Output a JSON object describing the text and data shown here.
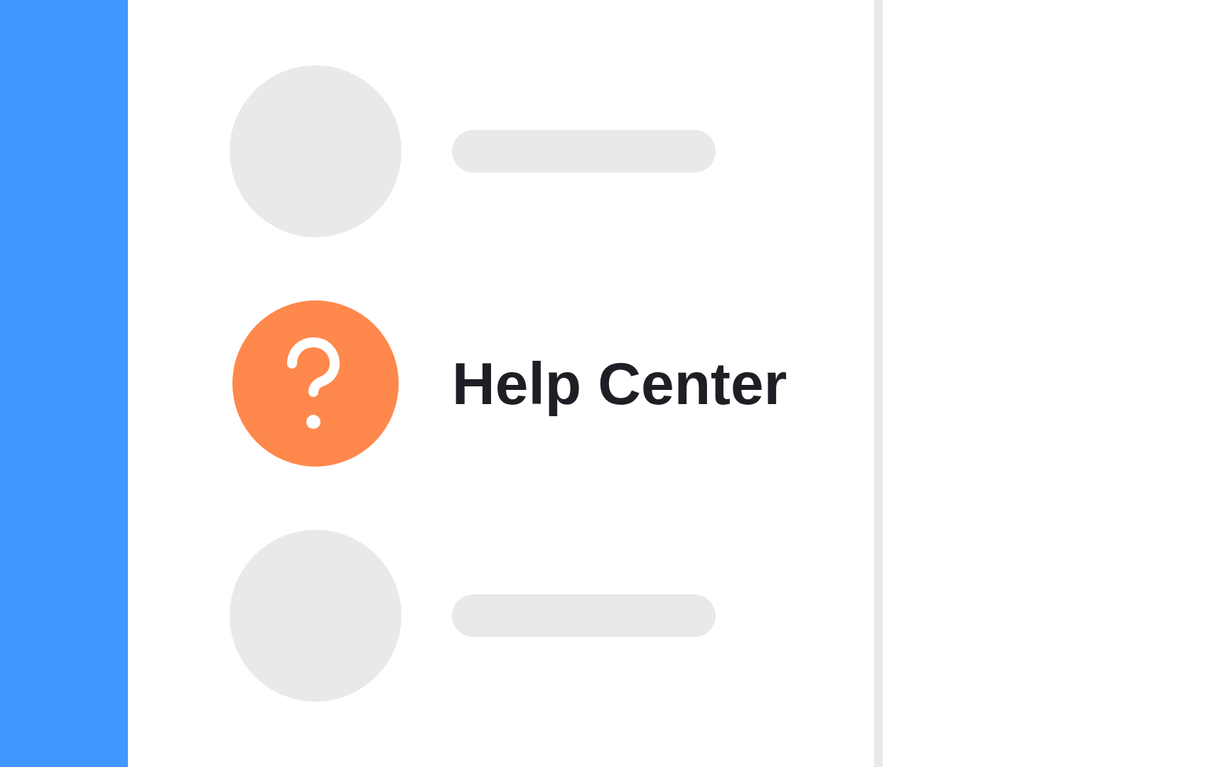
{
  "items": [
    {
      "kind": "placeholder"
    },
    {
      "kind": "help",
      "label": "Help Center"
    },
    {
      "kind": "placeholder"
    }
  ]
}
